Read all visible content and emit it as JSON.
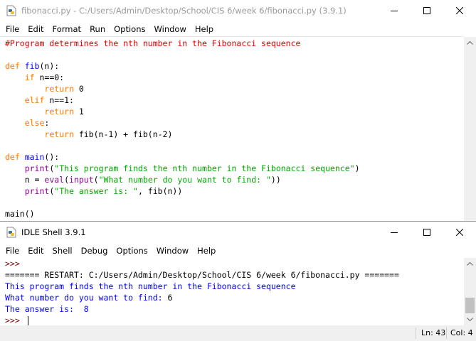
{
  "editor": {
    "title": "fibonacci.py - C:/Users/Admin/Desktop/School/CIS 6/week 6/fibonacci.py (3.9.1)",
    "menu": [
      "File",
      "Edit",
      "Format",
      "Run",
      "Options",
      "Window",
      "Help"
    ],
    "lines": [
      [
        {
          "t": "#Program determines the nth number in the Fibonacci sequence",
          "c": "cm"
        }
      ],
      [],
      [
        {
          "t": "def ",
          "c": "kw"
        },
        {
          "t": "fib",
          "c": "def"
        },
        {
          "t": "(n):",
          "c": "blk"
        }
      ],
      [
        {
          "t": "    ",
          "c": "blk"
        },
        {
          "t": "if",
          "c": "kw"
        },
        {
          "t": " n==0:",
          "c": "blk"
        }
      ],
      [
        {
          "t": "        ",
          "c": "blk"
        },
        {
          "t": "return",
          "c": "kw"
        },
        {
          "t": " 0",
          "c": "blk"
        }
      ],
      [
        {
          "t": "    ",
          "c": "blk"
        },
        {
          "t": "elif",
          "c": "kw"
        },
        {
          "t": " n==1:",
          "c": "blk"
        }
      ],
      [
        {
          "t": "        ",
          "c": "blk"
        },
        {
          "t": "return",
          "c": "kw"
        },
        {
          "t": " 1",
          "c": "blk"
        }
      ],
      [
        {
          "t": "    ",
          "c": "blk"
        },
        {
          "t": "else",
          "c": "kw"
        },
        {
          "t": ":",
          "c": "blk"
        }
      ],
      [
        {
          "t": "        ",
          "c": "blk"
        },
        {
          "t": "return",
          "c": "kw"
        },
        {
          "t": " fib(n-1) + fib(n-2)",
          "c": "blk"
        }
      ],
      [],
      [
        {
          "t": "def ",
          "c": "kw"
        },
        {
          "t": "main",
          "c": "def"
        },
        {
          "t": "():",
          "c": "blk"
        }
      ],
      [
        {
          "t": "    ",
          "c": "blk"
        },
        {
          "t": "print",
          "c": "bi"
        },
        {
          "t": "(",
          "c": "blk"
        },
        {
          "t": "\"This program finds the nth number in the Fibonacci sequence\"",
          "c": "str"
        },
        {
          "t": ")",
          "c": "blk"
        }
      ],
      [
        {
          "t": "    n = ",
          "c": "blk"
        },
        {
          "t": "eval",
          "c": "bi"
        },
        {
          "t": "(",
          "c": "blk"
        },
        {
          "t": "input",
          "c": "bi"
        },
        {
          "t": "(",
          "c": "blk"
        },
        {
          "t": "\"What number do you want to find: \"",
          "c": "str"
        },
        {
          "t": "))",
          "c": "blk"
        }
      ],
      [
        {
          "t": "    ",
          "c": "blk"
        },
        {
          "t": "print",
          "c": "bi"
        },
        {
          "t": "(",
          "c": "blk"
        },
        {
          "t": "\"The answer is: \"",
          "c": "str"
        },
        {
          "t": ", fib(n))",
          "c": "blk"
        }
      ],
      [],
      [
        {
          "t": "main()",
          "c": "blk"
        }
      ]
    ]
  },
  "shell": {
    "title": "IDLE Shell 3.9.1",
    "menu": [
      "File",
      "Edit",
      "Shell",
      "Debug",
      "Options",
      "Window",
      "Help"
    ],
    "lines": [
      [
        {
          "t": ">>>",
          "c": "prompt"
        }
      ],
      [
        {
          "t": "======= RESTART: C:/Users/Admin/Desktop/School/CIS 6/week 6/fibonacci.py =======",
          "c": "blk"
        }
      ],
      [
        {
          "t": "This program finds the nth number in the Fibonacci sequence",
          "c": "shout"
        }
      ],
      [
        {
          "t": "What number do you want to find: ",
          "c": "shout"
        },
        {
          "t": "6",
          "c": "blk"
        }
      ],
      [
        {
          "t": "The answer is:  8",
          "c": "shout"
        }
      ],
      [
        {
          "t": ">>> ",
          "c": "prompt"
        }
      ]
    ],
    "status": {
      "line": "Ln: 43",
      "col": "Col: 4"
    }
  },
  "icons": [
    "python-file-icon",
    "minimize-icon",
    "maximize-icon",
    "close-icon",
    "scroll-up-arrow-icon",
    "scroll-down-arrow-icon"
  ],
  "colors": {
    "keyword": "#ff7700",
    "definition": "#0000ff",
    "builtin": "#900090",
    "string": "#00aa00",
    "comment": "#dd0000",
    "shell_output": "#0000ff",
    "prompt": "#770000"
  }
}
